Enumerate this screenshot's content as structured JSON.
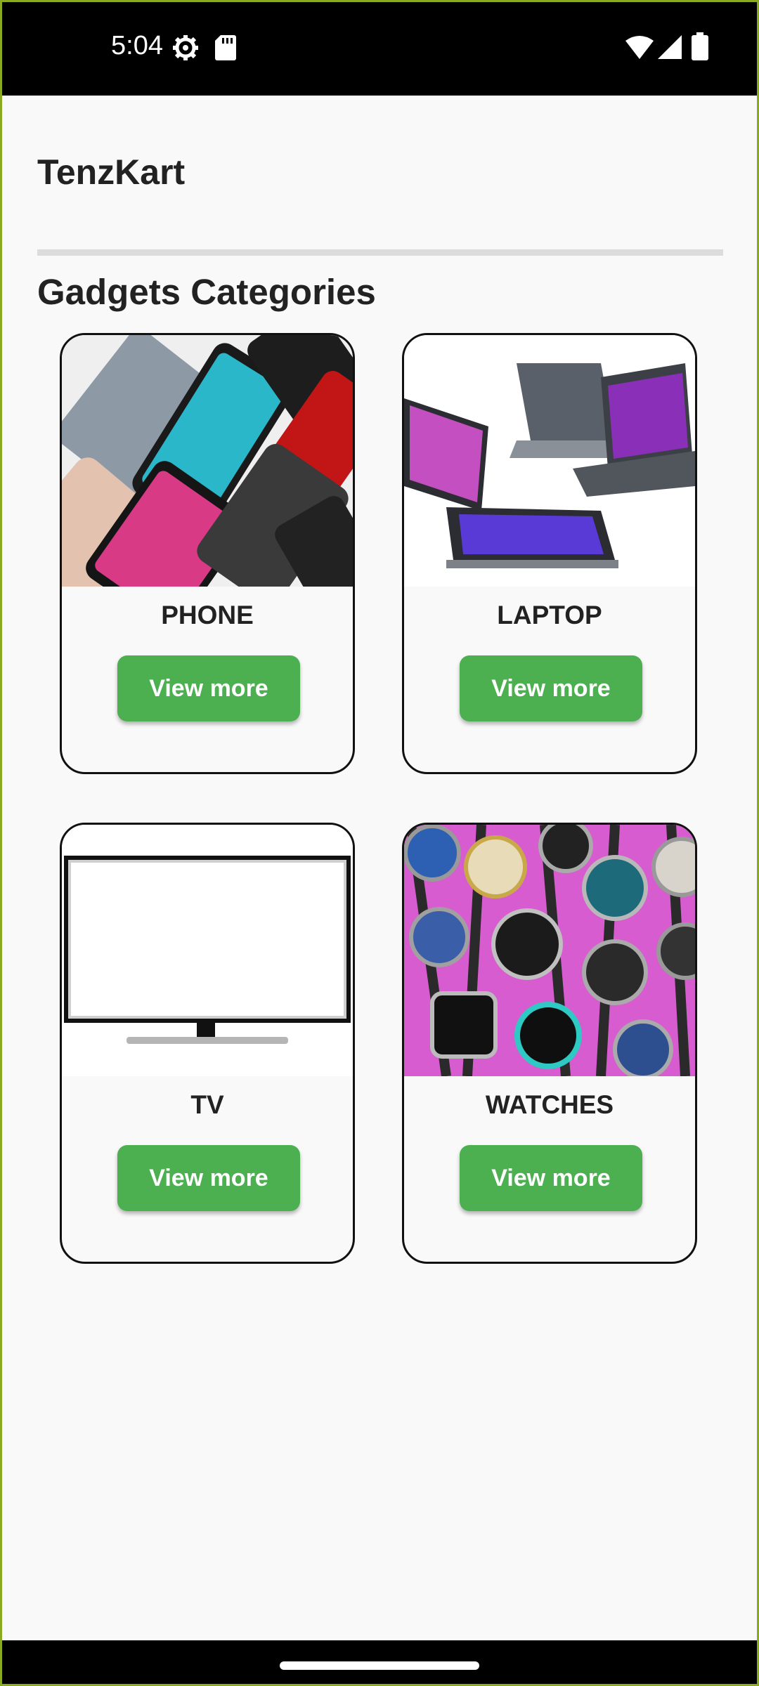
{
  "status_bar": {
    "time": "5:04",
    "icons": [
      "settings-gear-icon",
      "sd-card-icon",
      "wifi-icon",
      "cellular-signal-icon",
      "battery-icon"
    ]
  },
  "app": {
    "title": "TenzKart",
    "section_title": "Gadgets Categories",
    "accent_color": "#4caf50",
    "categories": [
      {
        "label": "PHONE",
        "button": "View more",
        "image": "phones-image"
      },
      {
        "label": "LAPTOP",
        "button": "View more",
        "image": "laptops-image"
      },
      {
        "label": "TV",
        "button": "View more",
        "image": "tv-image"
      },
      {
        "label": "WATCHES",
        "button": "View more",
        "image": "watches-image"
      }
    ]
  }
}
